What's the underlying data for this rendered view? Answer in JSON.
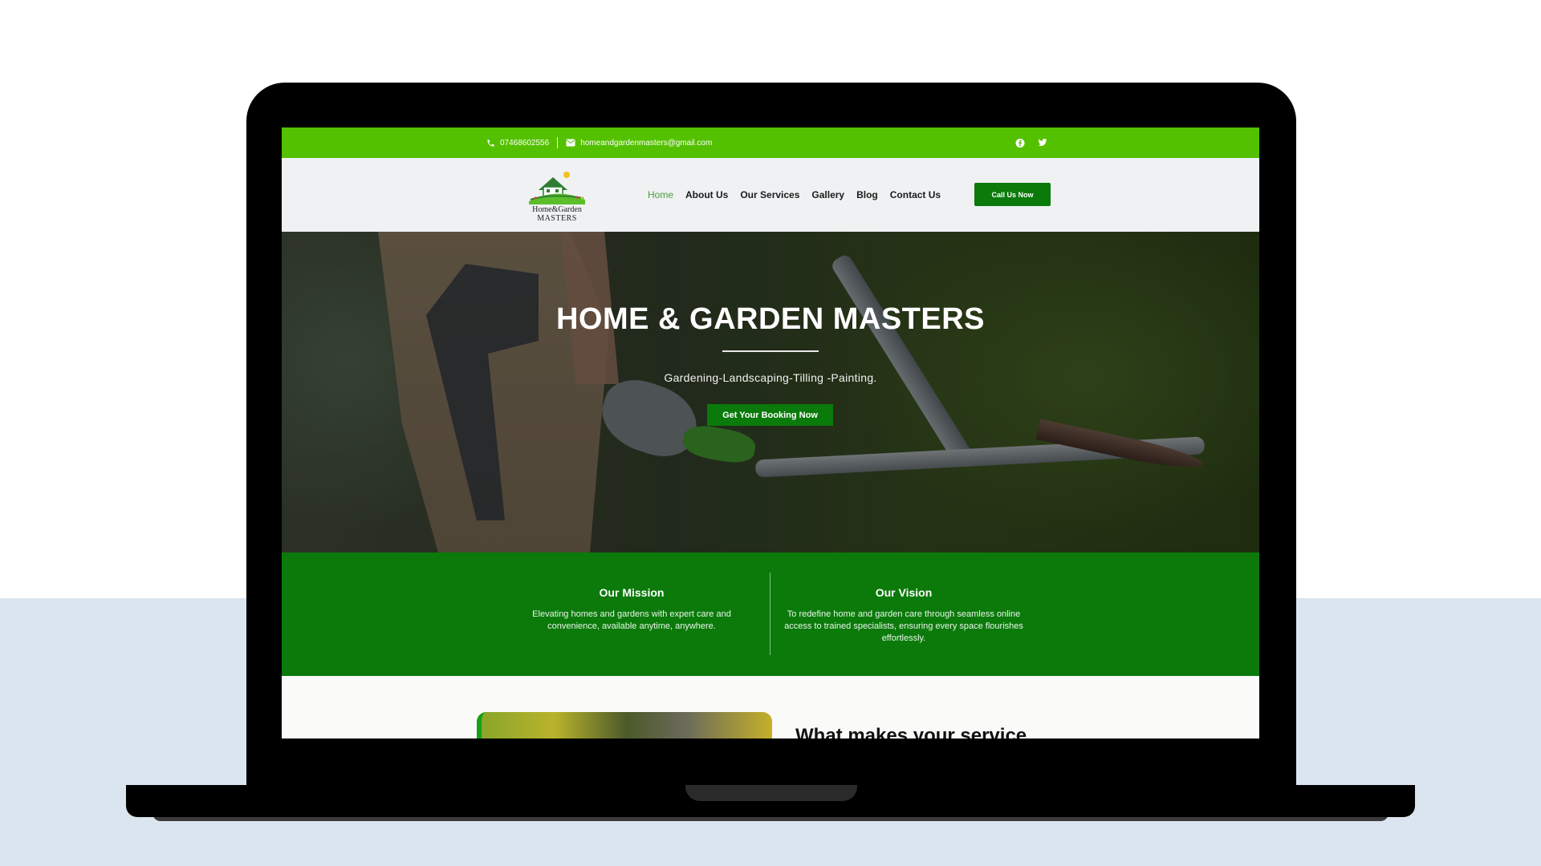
{
  "topbar": {
    "phone": "07468602556",
    "email": "homeandgardenmasters@gmail.com",
    "social_icons": [
      "facebook-icon",
      "twitter-icon"
    ]
  },
  "header": {
    "logo_line1": "Home&Garden",
    "logo_line2": "MASTERS",
    "nav": [
      {
        "label": "Home",
        "active": true
      },
      {
        "label": "About Us"
      },
      {
        "label": "Our Services"
      },
      {
        "label": "Gallery"
      },
      {
        "label": "Blog"
      },
      {
        "label": "Contact Us"
      }
    ],
    "cta": "Call Us Now"
  },
  "hero": {
    "title": "HOME & GARDEN MASTERS",
    "subtitle": "Gardening-Landscaping-Tilling -Painting.",
    "button": "Get Your Booking Now"
  },
  "mission": {
    "title": "Our Mission",
    "text": "Elevating homes and gardens with expert care and convenience, available anytime, anywhere."
  },
  "vision": {
    "title": "Our Vision",
    "text": "To redefine home and garden care through seamless online access to trained specialists, ensuring every space flourishes effortlessly."
  },
  "next_section": {
    "heading": "What makes your service"
  },
  "colors": {
    "topbar": "#54c100",
    "brand_green": "#0a7a0a",
    "nav_active": "#4c9d3a",
    "page_bg_lower": "#dbe5ef"
  }
}
